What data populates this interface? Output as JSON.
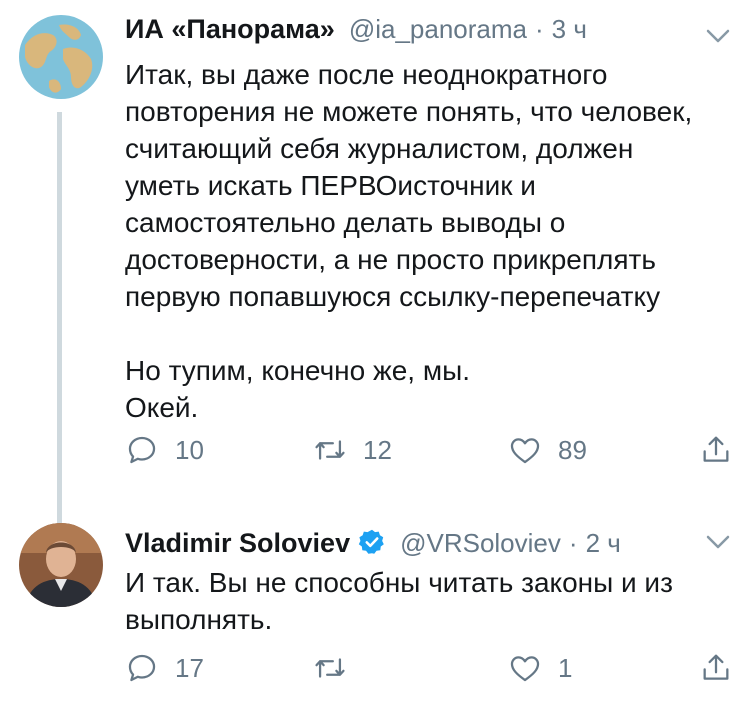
{
  "tweets": [
    {
      "display_name": "ИА «Панорама»",
      "handle": "@ia_panorama",
      "separator": "·",
      "time": "3 ч",
      "text": "Итак, вы даже после неоднократного\nповторения не можете понять, что человек,\nсчитающий себя журналистом, должен\nуметь искать ПЕРВОисточник и\nсамостоятельно делать выводы о\nдостоверности, а не просто прикреплять\nпервую попавшуюся ссылку-перепечатку\n\nНо тупим, конечно же, мы.\nОкей.",
      "replies": "10",
      "retweets": "12",
      "likes": "89",
      "avatar_icon": "globe-icon"
    },
    {
      "display_name": "Vladimir Soloviev",
      "handle": "@VRSoloviev",
      "separator": "·",
      "time": "2 ч",
      "text": "И так. Вы не способны читать законы и из\nвыполнять.",
      "replies": "17",
      "retweets": "",
      "likes": "1",
      "avatar_icon": "user-photo",
      "verified": true
    }
  ],
  "colors": {
    "text": "#14171a",
    "muted": "#657786",
    "verified": "#1da1f2",
    "thread_line": "#cfd9de"
  }
}
